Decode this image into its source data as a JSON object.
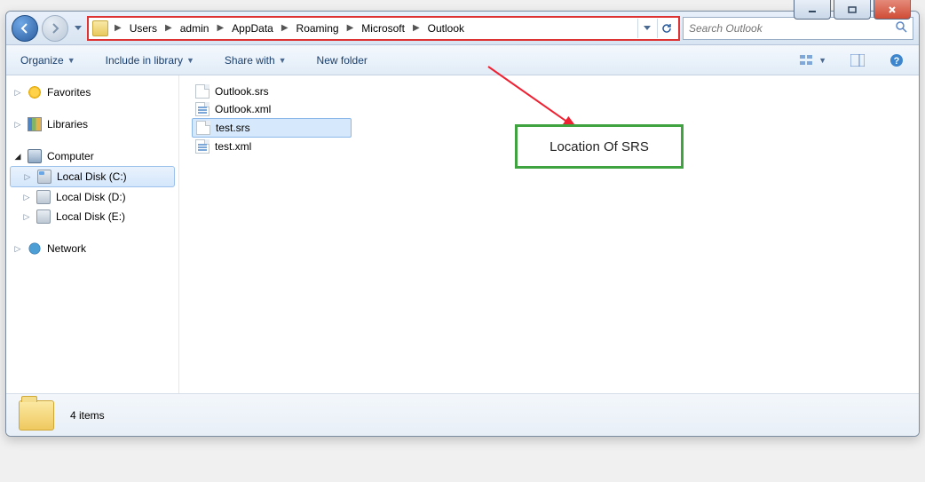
{
  "breadcrumb": [
    "Users",
    "admin",
    "AppData",
    "Roaming",
    "Microsoft",
    "Outlook"
  ],
  "search": {
    "placeholder": "Search Outlook"
  },
  "toolbar": {
    "organize": "Organize",
    "include": "Include in library",
    "share": "Share with",
    "newfolder": "New folder"
  },
  "sidebar": {
    "favorites": "Favorites",
    "libraries": "Libraries",
    "computer": "Computer",
    "drives": [
      "Local Disk (C:)",
      "Local Disk (D:)",
      "Local Disk (E:)"
    ],
    "network": "Network"
  },
  "files": [
    {
      "name": "Outlook.srs",
      "type": "srs",
      "selected": false
    },
    {
      "name": "Outlook.xml",
      "type": "xml",
      "selected": false
    },
    {
      "name": "test.srs",
      "type": "srs",
      "selected": true
    },
    {
      "name": "test.xml",
      "type": "xml",
      "selected": false
    }
  ],
  "annotation": {
    "label": "Location Of SRS"
  },
  "status": {
    "count_label": "4 items"
  }
}
